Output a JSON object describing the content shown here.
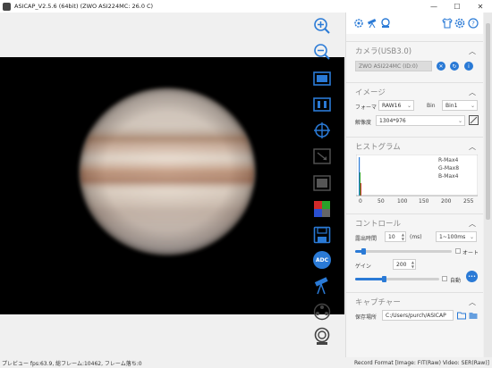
{
  "window": {
    "title": "ASICAP_V2.5.6 (64bit) (ZWO ASI224MC: 26.0 C)",
    "minimize": "—",
    "maximize": "☐",
    "close": "✕"
  },
  "colors": {
    "accent": "#2a7ad6",
    "preview_bg": "#000000"
  },
  "panel_top_icons": [
    "settings-cog-icon",
    "telescope-icon",
    "camera-cooler-icon",
    "shirt-theme-icon",
    "gear-icon",
    "help-icon"
  ],
  "camera": {
    "header": "カメラ(USB3.0)",
    "selected": "ZWO ASI224MC (ID:0)"
  },
  "image": {
    "header": "イメージ",
    "format_label": "フォーマ",
    "format_value": "RAW16",
    "bin_label": "Bin",
    "bin_value": "Bin1",
    "resolution_label": "解像度",
    "resolution_value": "1304*976"
  },
  "histogram": {
    "header": "ヒストグラム",
    "legend": [
      "R-Max4",
      "G-Max8",
      "B-Max4"
    ],
    "ticks": [
      "0",
      "50",
      "100",
      "150",
      "200",
      "255"
    ]
  },
  "control": {
    "header": "コントロール",
    "exposure_label": "露出時間",
    "exposure_value": "10",
    "exposure_unit": "(ms)",
    "exposure_range": "1~100ms",
    "exposure_slider": 0.08,
    "auto_label": "オート",
    "gain_label": "ゲイン",
    "gain_value": "200",
    "gain_slider": 0.34,
    "auto2_label": "自動",
    "more_btn": "•••"
  },
  "capture": {
    "header": "キャプチャー",
    "save_label": "保存場所",
    "save_path": "C:/Users/purch/ASICAP"
  },
  "toolbar_icons": [
    "zoom-in-icon",
    "zoom-out-icon",
    "fit-screen-icon",
    "actual-size-icon",
    "crosshair-icon",
    "roi-icon",
    "fullscreen-icon",
    "color-grid-icon",
    "save-icon",
    "adc-icon",
    "telescope-guide-icon",
    "filter-wheel-icon",
    "focuser-icon"
  ],
  "adc_label": "ADC",
  "status": {
    "left": "プレビュー fps:63.9, 総フレーム:10462, フレーム落ち:0",
    "right": "Record Format [Image: FIT(Raw) Video: SER(Raw)]"
  }
}
